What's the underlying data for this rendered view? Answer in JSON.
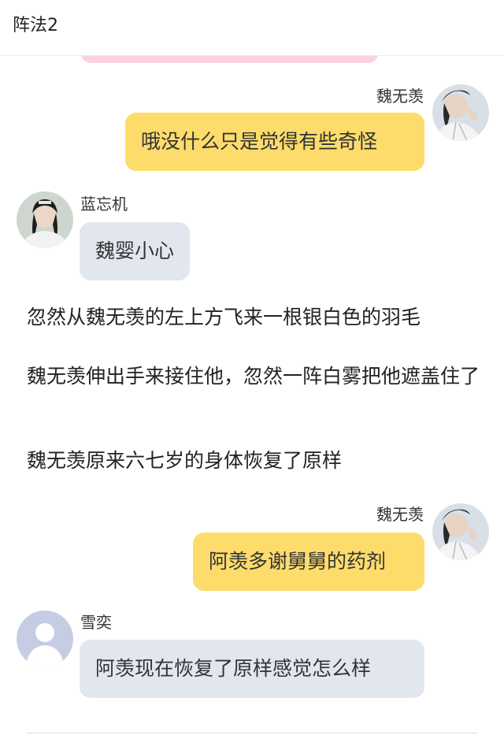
{
  "header": {
    "title": "阵法2"
  },
  "messages": [
    {
      "name": "魏无羡",
      "text": "哦没什么只是觉得有些奇怪",
      "avatar_icon": "character-portrait-icon",
      "bubble_color": "#fddc6c"
    },
    {
      "name": "蓝忘机",
      "text": "魏婴小心",
      "avatar_icon": "character-portrait-icon",
      "bubble_color": "#e2e7ef"
    },
    {
      "name": "魏无羡",
      "text": "阿羡多谢舅舅的药剂",
      "avatar_icon": "character-portrait-icon",
      "bubble_color": "#fddc6c"
    },
    {
      "name": "雪奕",
      "text": "阿羡现在恢复了原样感觉怎么样",
      "avatar_icon": "default-user-icon",
      "bubble_color": "#e2e7ef"
    }
  ],
  "narration": [
    "忽然从魏无羡的左上方飞来一根银白色的羽毛",
    "魏无羡伸出手来接住他，忽然一阵白雾把他遮盖住了",
    "魏无羡原来六七岁的身体恢复了原样"
  ]
}
